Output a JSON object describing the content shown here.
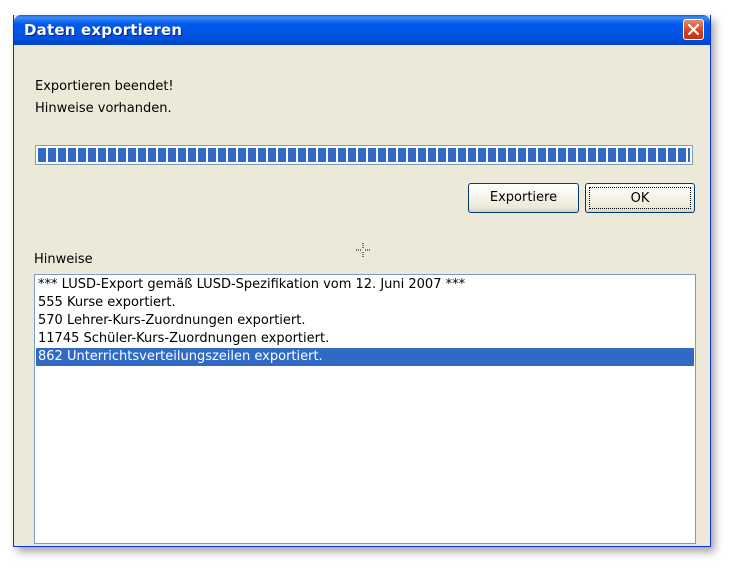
{
  "window": {
    "title": "Daten exportieren"
  },
  "status": {
    "line1": "Exportieren beendet!",
    "line2": "Hinweise vorhanden."
  },
  "progress": {
    "fraction": 1.0
  },
  "buttons": {
    "export_label": "Exportiere",
    "ok_label": "OK"
  },
  "notes": {
    "label": "Hinweise",
    "items": [
      "*** LUSD-Export gemäß LUSD-Spezifikation vom 12. Juni 2007 ***",
      "555 Kurse exportiert.",
      "570 Lehrer-Kurs-Zuordnungen exportiert.",
      "11745 Schüler-Kurs-Zuordnungen exportiert.",
      "862 Unterrichtsverteilungszeilen exportiert."
    ],
    "selected_index": 4
  },
  "colors": {
    "titlebar": "#0054e3",
    "selection": "#316ac5",
    "progress": "#3169c6",
    "close": "#d7411c"
  },
  "icons": {
    "close": "close-icon",
    "cursor": "crosshair-cursor-icon"
  }
}
